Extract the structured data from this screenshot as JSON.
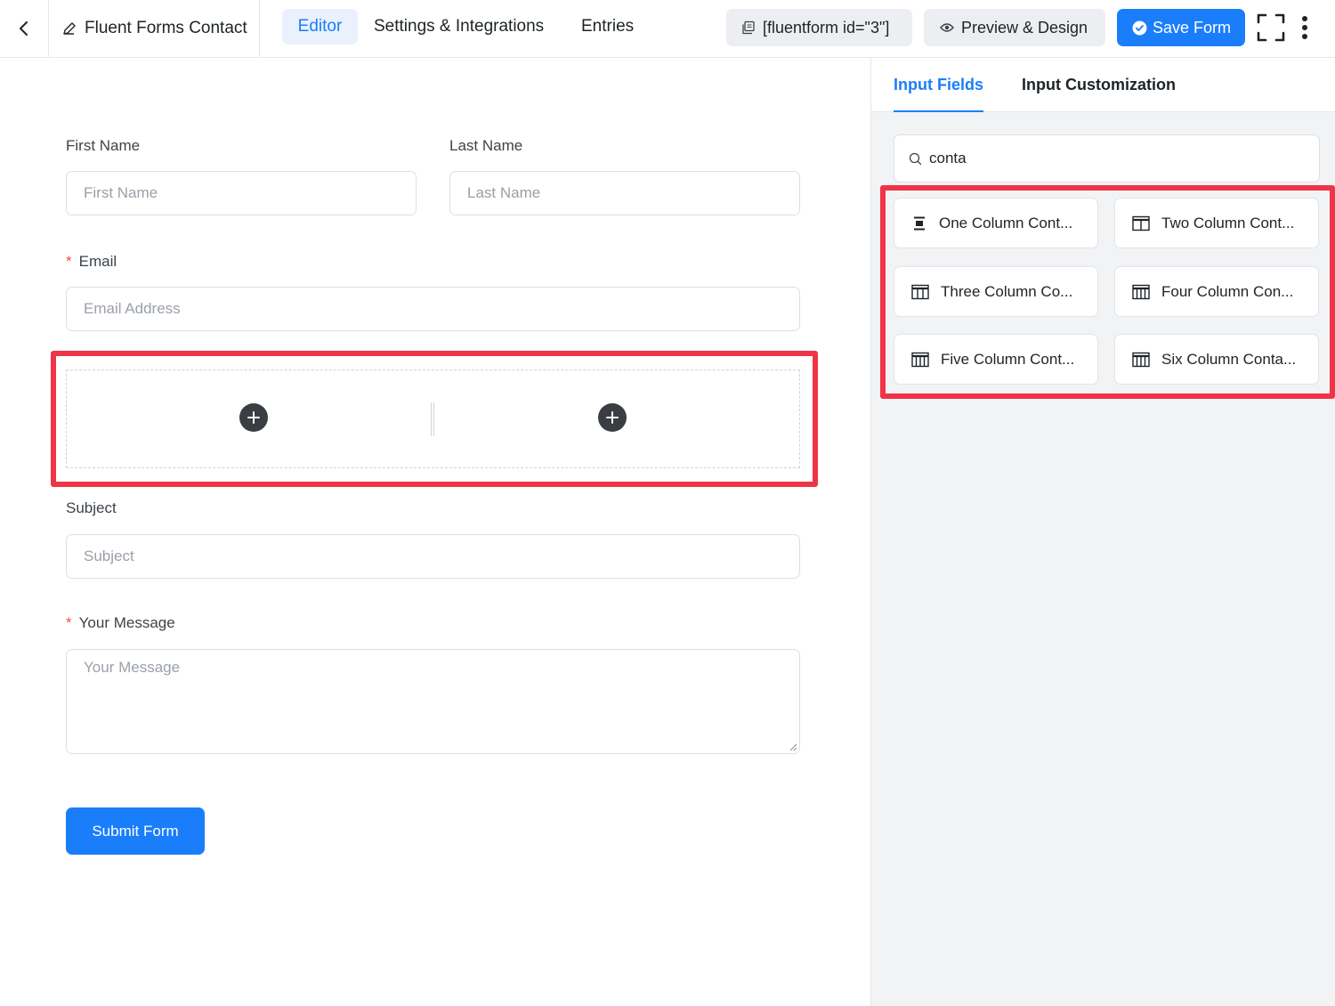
{
  "header": {
    "back_icon": "chevron-left-icon",
    "form_title": "Fluent Forms Contact",
    "tabs": [
      {
        "label": "Editor",
        "active": true
      },
      {
        "label": "Settings & Integrations",
        "active": false
      },
      {
        "label": "Entries",
        "active": false
      }
    ],
    "shortcode_label": "[fluentform id=\"3\"]",
    "preview_label": "Preview & Design",
    "save_label": "Save Form",
    "accent_color": "#1a7efb"
  },
  "form": {
    "first_name": {
      "label": "First Name",
      "placeholder": "First Name"
    },
    "last_name": {
      "label": "Last Name",
      "placeholder": "Last Name"
    },
    "email": {
      "label": "Email",
      "placeholder": "Email Address",
      "required": true
    },
    "subject": {
      "label": "Subject",
      "placeholder": "Subject"
    },
    "message": {
      "label": "Your Message",
      "placeholder": "Your Message",
      "required": true
    },
    "required_mark": "*",
    "submit_label": "Submit Form"
  },
  "sidebar": {
    "tabs": [
      {
        "label": "Input Fields",
        "active": true
      },
      {
        "label": "Input Customization",
        "active": false
      }
    ],
    "search_value": "conta",
    "fields": [
      {
        "label": "One Column Cont...",
        "icon": "one-column-icon"
      },
      {
        "label": "Two Column Cont...",
        "icon": "two-column-icon"
      },
      {
        "label": "Three Column Co...",
        "icon": "three-column-icon"
      },
      {
        "label": "Four Column Con...",
        "icon": "four-column-icon"
      },
      {
        "label": "Five Column Cont...",
        "icon": "five-column-icon"
      },
      {
        "label": "Six Column Conta...",
        "icon": "six-column-icon"
      }
    ],
    "highlight_color": "#f03447"
  }
}
